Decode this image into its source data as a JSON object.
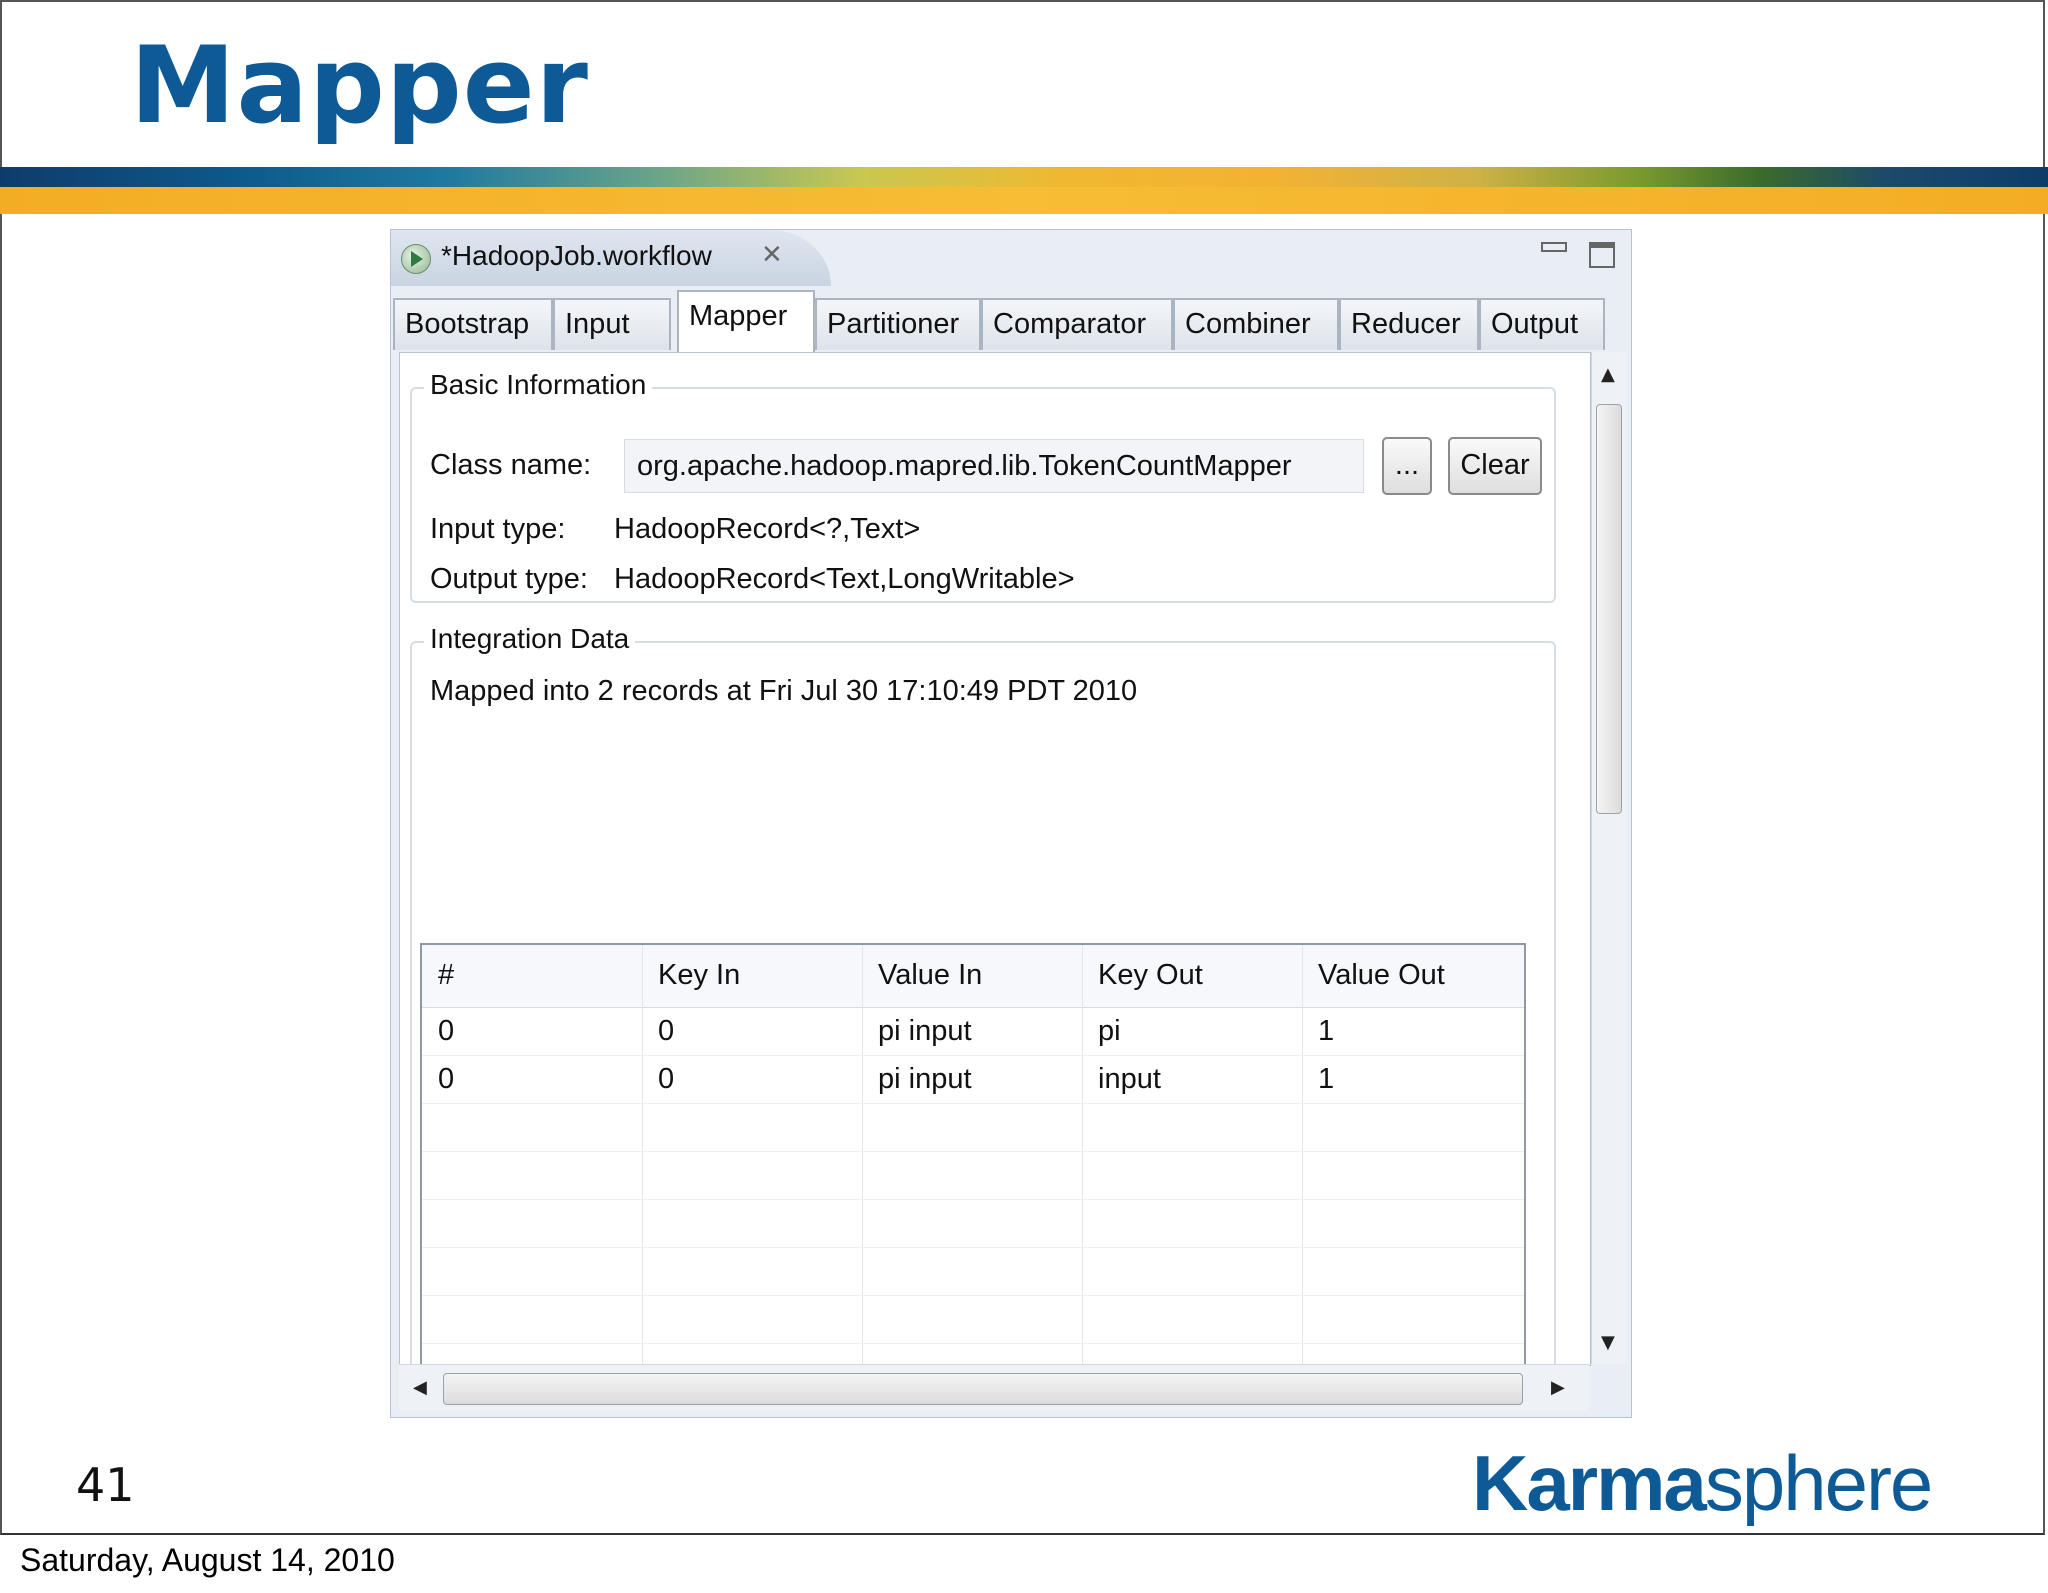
{
  "slide": {
    "title": "Mapper",
    "page_number": "41",
    "footer_date": "Saturday, August 14, 2010",
    "logo_part1": "Karma",
    "logo_part2": "sphere"
  },
  "window": {
    "tab_title": "*HadoopJob.workflow",
    "tabs": [
      "Bootstrap",
      "Input",
      "Mapper",
      "Partitioner",
      "Comparator",
      "Combiner",
      "Reducer",
      "Output"
    ],
    "active_tab": "Mapper"
  },
  "basic_info": {
    "section_label": "Basic Information",
    "class_name_label": "Class name:",
    "class_name_value": "org.apache.hadoop.mapred.lib.TokenCountMapper",
    "browse_label": "...",
    "clear_label": "Clear",
    "input_type_label": "Input type:",
    "input_type_value": "HadoopRecord<?,Text>",
    "output_type_label": "Output type:",
    "output_type_value": "HadoopRecord<Text,LongWritable>"
  },
  "integration": {
    "section_label": "Integration Data",
    "status": "Mapped into 2 records at Fri Jul 30 17:10:49 PDT 2010",
    "columns": [
      "#",
      "Key In",
      "Value In",
      "Key Out",
      "Value Out"
    ],
    "rows": [
      [
        "0",
        "0",
        "pi input",
        "pi",
        "1"
      ],
      [
        "0",
        "0",
        "pi input",
        "input",
        "1"
      ]
    ]
  },
  "colors": {
    "title_blue": "#0d5a96",
    "stripe_gold": "#f4b233"
  }
}
